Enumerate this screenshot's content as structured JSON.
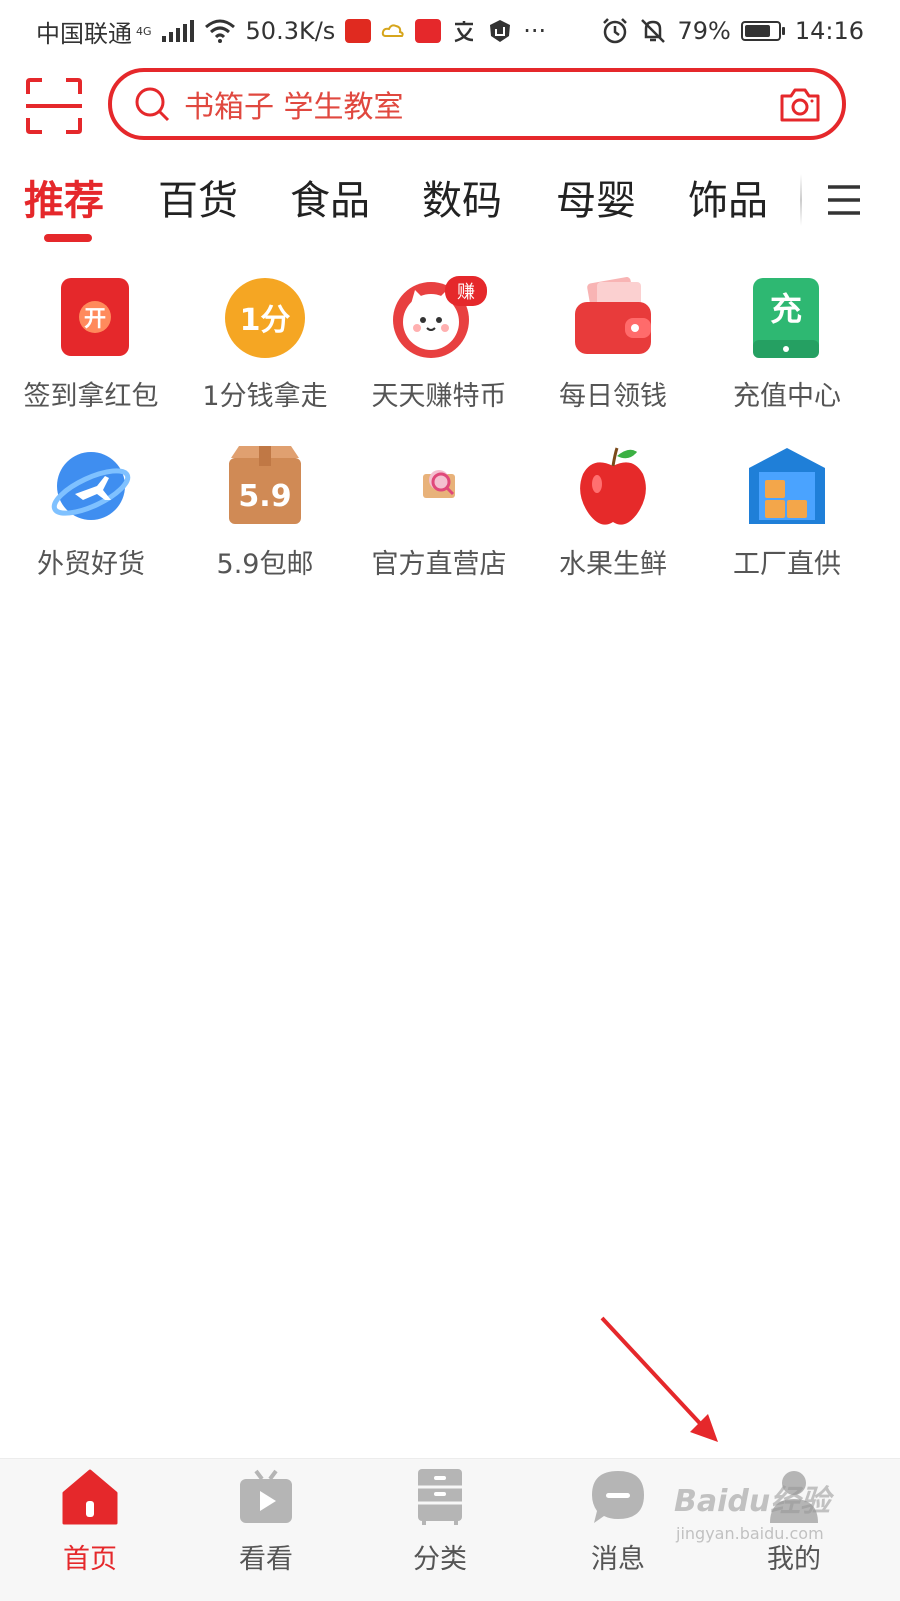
{
  "status_bar": {
    "carrier": "中国联通",
    "network": "4G",
    "speed": "50.3K/s",
    "more": "···",
    "battery": "79%",
    "battery_level": 0.79,
    "time": "14:16"
  },
  "search": {
    "placeholder": "书箱子 学生教室"
  },
  "tabs": [
    {
      "label": "推荐",
      "active": true
    },
    {
      "label": "百货"
    },
    {
      "label": "食品"
    },
    {
      "label": "数码"
    },
    {
      "label": "母婴"
    },
    {
      "label": "饰品"
    }
  ],
  "grid": [
    {
      "label": "签到拿红包",
      "icon": "red-envelope-open-icon",
      "glyph": "开"
    },
    {
      "label": "1分钱拿走",
      "icon": "one-cent-coin-icon",
      "glyph": "1分"
    },
    {
      "label": "天天赚特币",
      "icon": "cat-earn-icon",
      "badge": "赚"
    },
    {
      "label": "每日领钱",
      "icon": "wallet-icon"
    },
    {
      "label": "充值中心",
      "icon": "phone-recharge-icon",
      "glyph": "充"
    },
    {
      "label": "外贸好货",
      "icon": "globe-plane-icon"
    },
    {
      "label": "5.9包邮",
      "icon": "parcel-box-icon",
      "glyph": "5.9"
    },
    {
      "label": "官方直营店",
      "icon": "official-store-icon"
    },
    {
      "label": "水果生鲜",
      "icon": "apple-icon"
    },
    {
      "label": "工厂直供",
      "icon": "factory-icon"
    }
  ],
  "bottom_nav": [
    {
      "label": "首页",
      "icon": "home-icon",
      "active": true
    },
    {
      "label": "看看",
      "icon": "video-tv-icon"
    },
    {
      "label": "分类",
      "icon": "category-cabinet-icon"
    },
    {
      "label": "消息",
      "icon": "message-bubble-icon"
    },
    {
      "label": "我的",
      "icon": "user-profile-icon"
    }
  ],
  "watermark": {
    "main": "Baidu经验",
    "sub": "jingyan.baidu.com"
  },
  "colors": {
    "brand_red": "#e5282b",
    "nav_inactive": "#b5b5b5"
  }
}
